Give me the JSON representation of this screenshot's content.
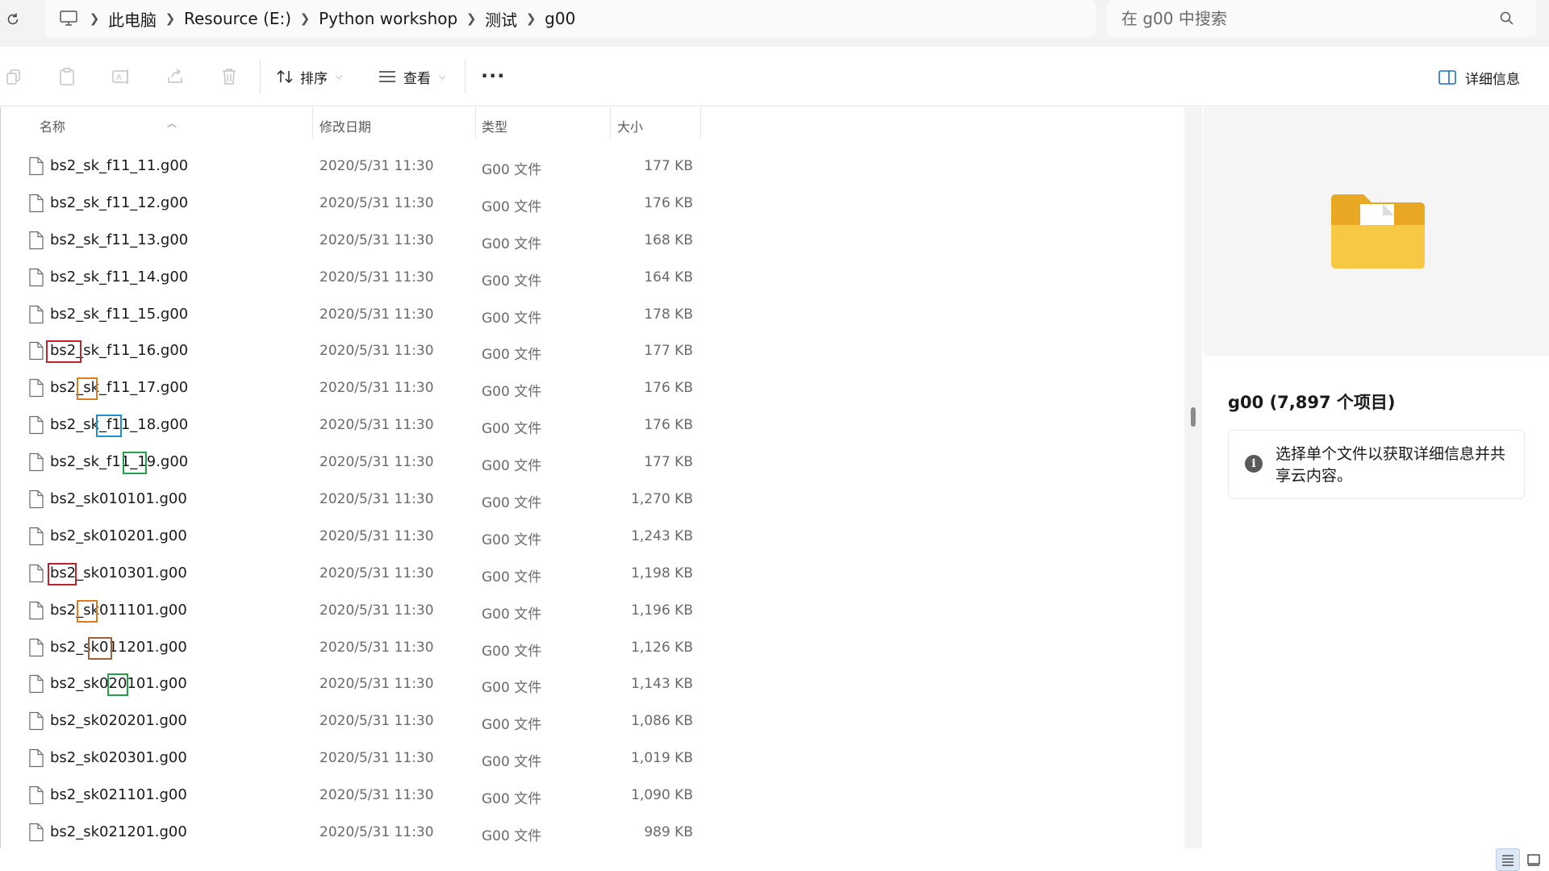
{
  "address": {
    "crumbs": [
      "此电脑",
      "Resource (E:)",
      "Python workshop",
      "测试",
      "g00"
    ],
    "search_placeholder": "在 g00 中搜索"
  },
  "commandbar": {
    "sort_label": "排序",
    "view_label": "查看",
    "more_label": "···",
    "details_label": "详细信息"
  },
  "columns": {
    "name": "名称",
    "date": "修改日期",
    "type": "类型",
    "size": "大小"
  },
  "files": [
    {
      "name": "bs2_sk_f11_11.g00",
      "date": "2020/5/31 11:30",
      "type": "G00 文件",
      "size": "177 KB"
    },
    {
      "name": "bs2_sk_f11_12.g00",
      "date": "2020/5/31 11:30",
      "type": "G00 文件",
      "size": "176 KB"
    },
    {
      "name": "bs2_sk_f11_13.g00",
      "date": "2020/5/31 11:30",
      "type": "G00 文件",
      "size": "168 KB"
    },
    {
      "name": "bs2_sk_f11_14.g00",
      "date": "2020/5/31 11:30",
      "type": "G00 文件",
      "size": "164 KB"
    },
    {
      "name": "bs2_sk_f11_15.g00",
      "date": "2020/5/31 11:30",
      "type": "G00 文件",
      "size": "178 KB"
    },
    {
      "name": "bs2_sk_f11_16.g00",
      "date": "2020/5/31 11:30",
      "type": "G00 文件",
      "size": "177 KB"
    },
    {
      "name": "bs2_sk_f11_17.g00",
      "date": "2020/5/31 11:30",
      "type": "G00 文件",
      "size": "176 KB"
    },
    {
      "name": "bs2_sk_f11_18.g00",
      "date": "2020/5/31 11:30",
      "type": "G00 文件",
      "size": "176 KB"
    },
    {
      "name": "bs2_sk_f11_19.g00",
      "date": "2020/5/31 11:30",
      "type": "G00 文件",
      "size": "177 KB"
    },
    {
      "name": "bs2_sk010101.g00",
      "date": "2020/5/31 11:30",
      "type": "G00 文件",
      "size": "1,270 KB"
    },
    {
      "name": "bs2_sk010201.g00",
      "date": "2020/5/31 11:30",
      "type": "G00 文件",
      "size": "1,243 KB"
    },
    {
      "name": "bs2_sk010301.g00",
      "date": "2020/5/31 11:30",
      "type": "G00 文件",
      "size": "1,198 KB"
    },
    {
      "name": "bs2_sk011101.g00",
      "date": "2020/5/31 11:30",
      "type": "G00 文件",
      "size": "1,196 KB"
    },
    {
      "name": "bs2_sk011201.g00",
      "date": "2020/5/31 11:30",
      "type": "G00 文件",
      "size": "1,126 KB"
    },
    {
      "name": "bs2_sk020101.g00",
      "date": "2020/5/31 11:30",
      "type": "G00 文件",
      "size": "1,143 KB"
    },
    {
      "name": "bs2_sk020201.g00",
      "date": "2020/5/31 11:30",
      "type": "G00 文件",
      "size": "1,086 KB"
    },
    {
      "name": "bs2_sk020301.g00",
      "date": "2020/5/31 11:30",
      "type": "G00 文件",
      "size": "1,019 KB"
    },
    {
      "name": "bs2_sk021101.g00",
      "date": "2020/5/31 11:30",
      "type": "G00 文件",
      "size": "1,090 KB"
    },
    {
      "name": "bs2_sk021201.g00",
      "date": "2020/5/31 11:30",
      "type": "G00 文件",
      "size": "989 KB"
    }
  ],
  "annotation_colors": {
    "red": "#c0232b",
    "orange": "#e07a1f",
    "blue": "#1e8fd0",
    "green": "#22a04a",
    "brown": "#a0603a"
  },
  "details": {
    "title": "g00 (7,897 个项目)",
    "info_text": "选择单个文件以获取详细信息并共享云内容。",
    "folder_color": "#f7c843"
  },
  "icons": {
    "refresh": "refresh-icon",
    "pc": "computer-icon",
    "search": "search-icon",
    "copy": "copy-icon",
    "paste": "paste-icon",
    "rename": "rename-icon",
    "share": "share-icon",
    "delete": "delete-icon",
    "sort": "sort-icon",
    "view": "view-icon",
    "details": "details-pane-icon",
    "file": "file-icon",
    "info": "info-icon"
  }
}
